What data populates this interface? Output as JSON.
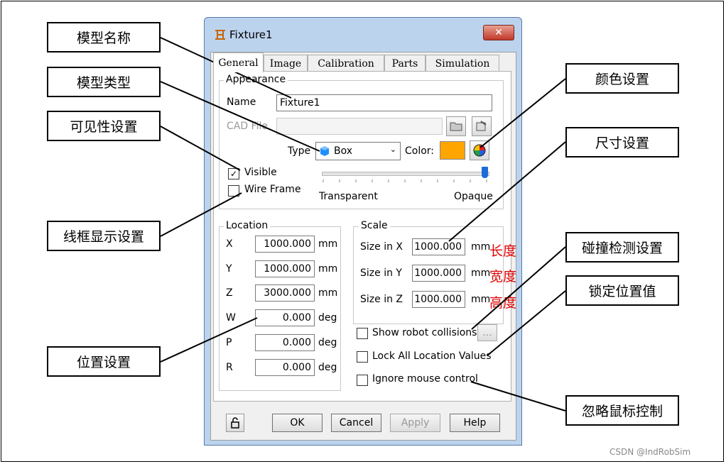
{
  "callouts": {
    "model_name": "模型名称",
    "model_type": "模型类型",
    "visibility": "可见性设置",
    "wireframe": "线框显示设置",
    "position": "位置设置",
    "color": "颜色设置",
    "size": "尺寸设置",
    "collision": "碰撞检测设置",
    "lock": "锁定位置值",
    "ignore_mouse": "忽略鼠标控制"
  },
  "dialog": {
    "title": "Fixture1",
    "close": "✕",
    "tabs": [
      "General",
      "Image",
      "Calibration",
      "Parts",
      "Simulation"
    ],
    "appearance": {
      "group": "Appearance",
      "name_label": "Name",
      "name_value": "Fixture1",
      "cad_label": "CAD File",
      "cad_value": "",
      "type_label": "Type",
      "type_value": "Box",
      "color_label": "Color:",
      "color_value": "#ffa500",
      "visible_label": "Visible",
      "visible_checked": true,
      "wireframe_label": "Wire Frame",
      "wireframe_checked": false,
      "opacity_min": "Transparent",
      "opacity_max": "Opaque",
      "opacity_level": 1.0
    },
    "location": {
      "group": "Location",
      "rows": [
        {
          "label": "X",
          "value": "1000.000",
          "unit": "mm"
        },
        {
          "label": "Y",
          "value": "1000.000",
          "unit": "mm"
        },
        {
          "label": "Z",
          "value": "3000.000",
          "unit": "mm"
        },
        {
          "label": "W",
          "value": "0.000",
          "unit": "deg"
        },
        {
          "label": "P",
          "value": "0.000",
          "unit": "deg"
        },
        {
          "label": "R",
          "value": "0.000",
          "unit": "deg"
        }
      ]
    },
    "scale": {
      "group": "Scale",
      "rows": [
        {
          "label": "Size in X",
          "value": "1000.000",
          "unit": "mm",
          "note": "长度"
        },
        {
          "label": "Size in Y",
          "value": "1000.000",
          "unit": "mm",
          "note": "宽度"
        },
        {
          "label": "Size in Z",
          "value": "1000.000",
          "unit": "mm",
          "note": "高度"
        }
      ]
    },
    "options": {
      "show_collisions": "Show robot collisions",
      "collisions_btn": "...",
      "lock_values": "Lock All Location Values",
      "ignore_mouse": "Ignore mouse control"
    },
    "buttons": {
      "ok": "OK",
      "cancel": "Cancel",
      "apply": "Apply",
      "help": "Help"
    }
  },
  "watermark": "CSDN @IndRobSim"
}
